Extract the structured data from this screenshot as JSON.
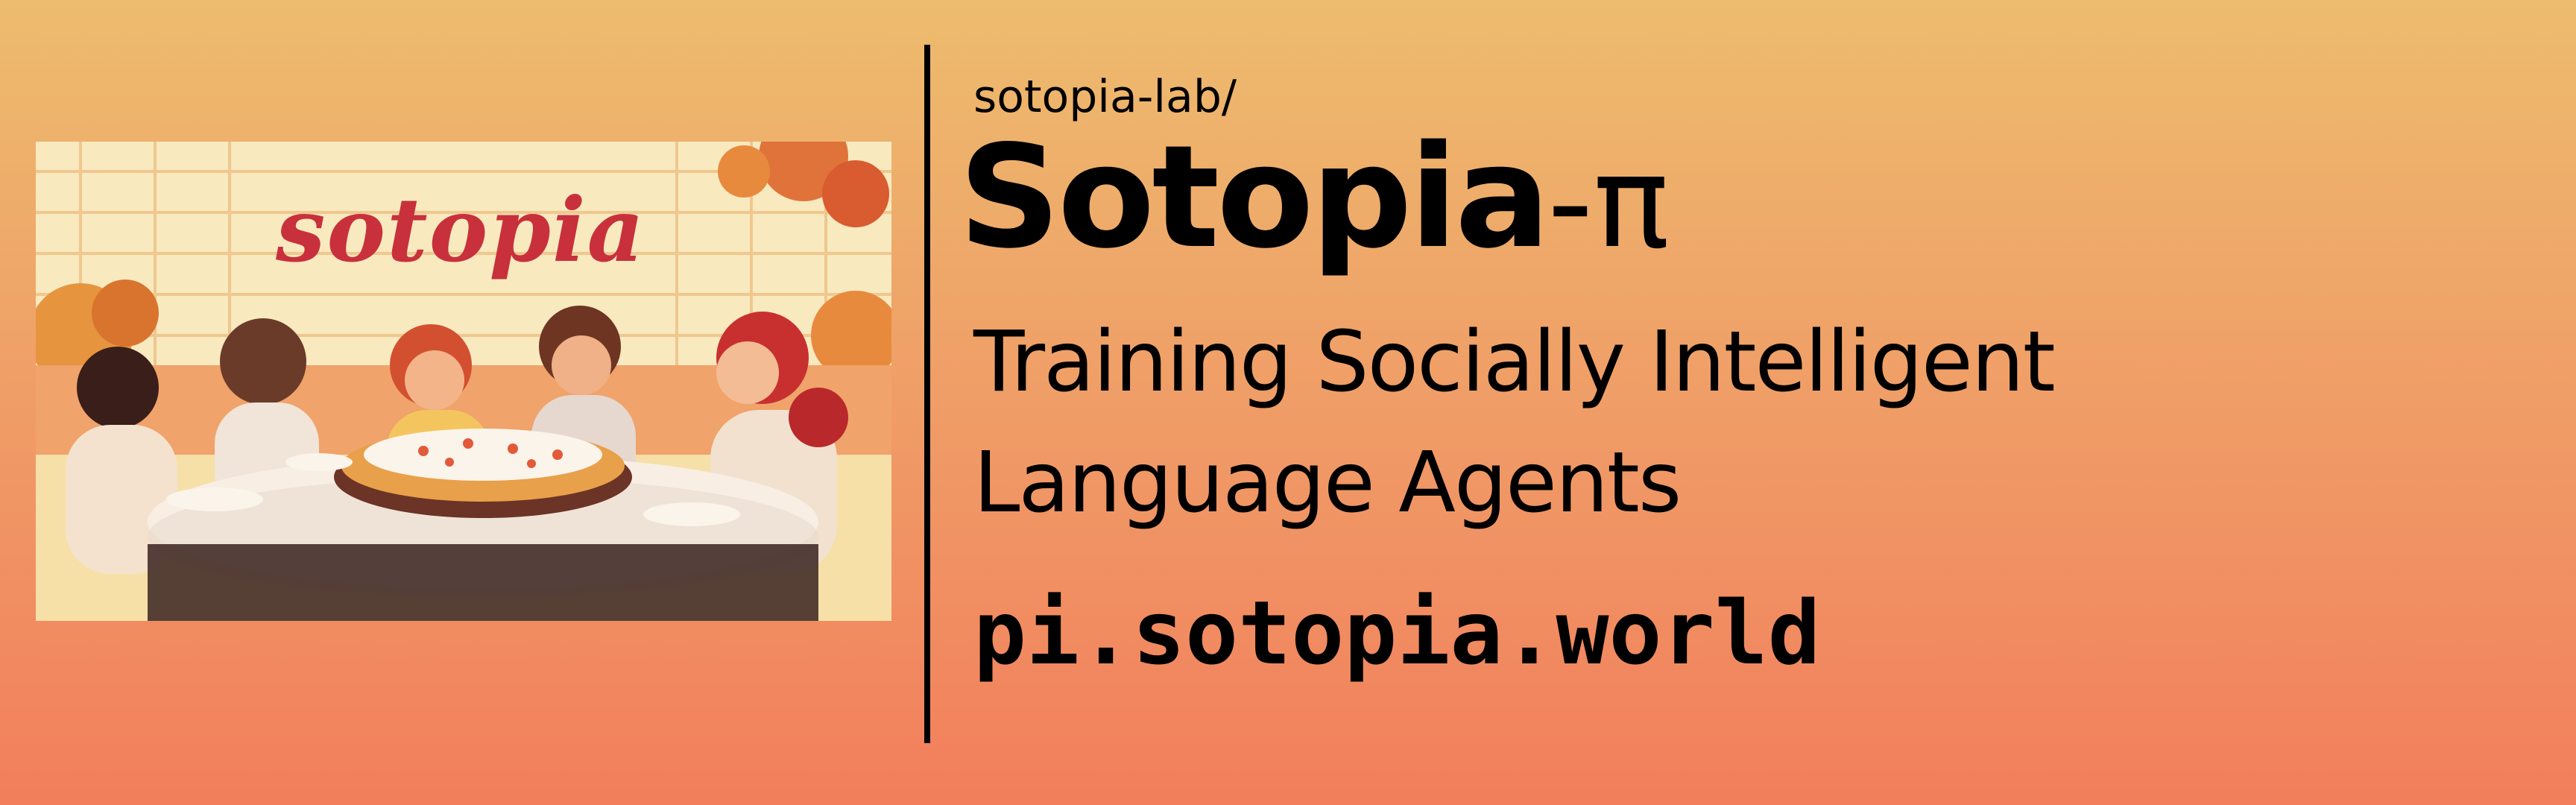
{
  "banner": {
    "illustration": {
      "word": "sotopia"
    },
    "org": "sotopia-lab/",
    "title": {
      "main": "Sotopia",
      "suffix": "-π"
    },
    "subtitle": {
      "line1": "Training Socially Intelligent",
      "line2": "Language Agents"
    },
    "url": "pi.sotopia.world"
  },
  "colors": {
    "gradient_top": "#EDBC6E",
    "gradient_bottom": "#F27E5C",
    "text": "#000000",
    "illustration_word": "#C8303C"
  }
}
